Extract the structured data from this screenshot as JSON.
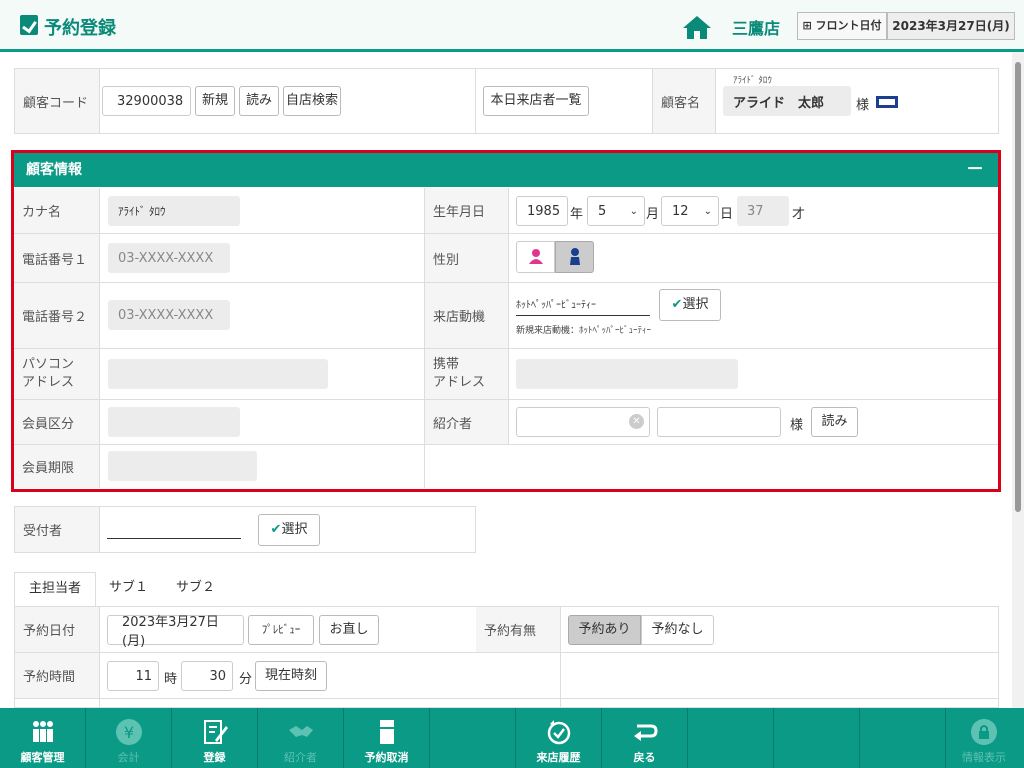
{
  "header": {
    "title": "予約登録",
    "store": "三鷹店",
    "front_label": "フロント日付",
    "date": "2023年3月27日(月)"
  },
  "customer_bar": {
    "code_label": "顧客コード",
    "code_value": "32900038",
    "new_btn": "新規",
    "read_btn": "読み",
    "store_search_btn": "自店検索",
    "today_list_btn": "本日来店者一覧",
    "name_label": "顧客名",
    "name_kana": "ｱﾗｲﾄﾞ ﾀﾛｳ",
    "name_value": "アライド　太郎",
    "honorific": "様"
  },
  "customer_info": {
    "title": "顧客情報",
    "collapse": "－",
    "kana_label": "カナ名",
    "kana_value": "ｱﾗｲﾄﾞ ﾀﾛｳ",
    "phone1_label": "電話番号１",
    "phone1_placeholder": "03-XXXX-XXXX",
    "phone2_label": "電話番号２",
    "phone2_placeholder": "03-XXXX-XXXX",
    "pc_address_label_1": "パソコン",
    "pc_address_label_2": "アドレス",
    "member_type_label": "会員区分",
    "member_expiry_label": "会員期限",
    "birth_label": "生年月日",
    "birth_year": "1985",
    "year_unit": "年",
    "birth_month": "5",
    "month_unit": "月",
    "birth_day": "12",
    "day_unit": "日",
    "age": "37",
    "age_unit": "才",
    "gender_label": "性別",
    "motive_label": "来店動機",
    "motive_value": "ﾎｯﾄﾍﾟｯﾊﾟｰﾋﾞｭｰﾃｨｰ",
    "select_btn": "選択",
    "motive_note": "新規来店動機：ﾎｯﾄﾍﾟｯﾊﾟｰﾋﾞｭｰﾃｨｰ",
    "mobile_label_1": "携帯",
    "mobile_label_2": "アドレス",
    "referrer_label": "紹介者",
    "referrer_honorific": "様",
    "referrer_read_btn": "読み"
  },
  "receptionist": {
    "label": "受付者",
    "select_btn": "選択"
  },
  "tabs": [
    "主担当者",
    "サブ１",
    "サブ２"
  ],
  "reservation": {
    "date_label": "予約日付",
    "date_value": "2023年3月27日 (月)",
    "preview_btn": "ﾌﾟﾚﾋﾞｭｰ",
    "fix_btn": "お直し",
    "status_label": "予約有無",
    "status_yes": "予約あり",
    "status_no": "予約なし",
    "time_label": "予約時間",
    "hour": "11",
    "hour_unit": "時",
    "minute": "30",
    "minute_unit": "分",
    "now_btn": "現在時刻"
  },
  "footer": [
    {
      "label": "顧客管理",
      "icon": "people-icon",
      "enabled": true
    },
    {
      "label": "会計",
      "icon": "yen-icon",
      "enabled": false
    },
    {
      "label": "登録",
      "icon": "edit-icon",
      "enabled": true
    },
    {
      "label": "紹介者",
      "icon": "handshake-icon",
      "enabled": false
    },
    {
      "label": "予約取消",
      "icon": "cancel-icon",
      "enabled": true
    },
    {
      "label": "",
      "icon": "",
      "enabled": false
    },
    {
      "label": "来店履歴",
      "icon": "history-icon",
      "enabled": true
    },
    {
      "label": "戻る",
      "icon": "return-icon",
      "enabled": true
    },
    {
      "label": "情報表示",
      "icon": "lock-icon",
      "enabled": false
    }
  ],
  "colors": {
    "accent": "#0a9a86",
    "highlight_border": "#d9001b",
    "female": "#e0368c",
    "male": "#1a3f8f"
  }
}
